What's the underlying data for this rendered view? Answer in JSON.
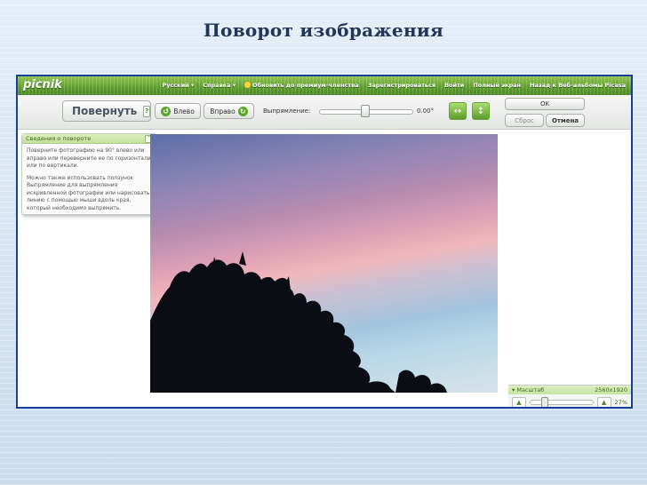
{
  "slide": {
    "title": "Поворот изображения"
  },
  "app": {
    "logo": "picnik",
    "topnav": {
      "language": "Русский",
      "help": "Справка",
      "upgrade": "Обновить до премиум-членства",
      "register": "Зарегистрироваться",
      "login": "Войти",
      "fullscreen": "Полный экран",
      "back": "Назад к Веб-альбомы Picasa"
    }
  },
  "toolbar": {
    "tool_title": "Повернуть",
    "help_badge": "?",
    "rotate_left": "Влево",
    "rotate_right": "Вправо",
    "straighten_label": "Выпрямление:",
    "straighten_value": "0.00°",
    "ok": "OK",
    "reset": "Сброс",
    "cancel": "Отмена"
  },
  "info_panel": {
    "title": "Сведения о повороте",
    "paragraph1": "Поверните фотографию на 90° влево или вправо или переверните ее по горизонтали или по вертикали.",
    "paragraph2": "Можно также использовать ползунок Выпрямление для выпрямления искривленной фотографии или нарисовать линию с помощью мыши вдоль края, который необходимо выпрямить."
  },
  "zoom": {
    "label": "Масштаб",
    "dimensions": "2560x1920",
    "percent": "27%"
  },
  "icons": {
    "rotate_left": "rotate-left-icon",
    "rotate_right": "rotate-right-icon",
    "flip_horizontal": "flip-horizontal-icon",
    "flip_vertical": "flip-vertical-icon"
  },
  "colors": {
    "slide_title": "#23365a",
    "frame_border": "#1b3f99",
    "brand_green": "#5c9d2a"
  }
}
